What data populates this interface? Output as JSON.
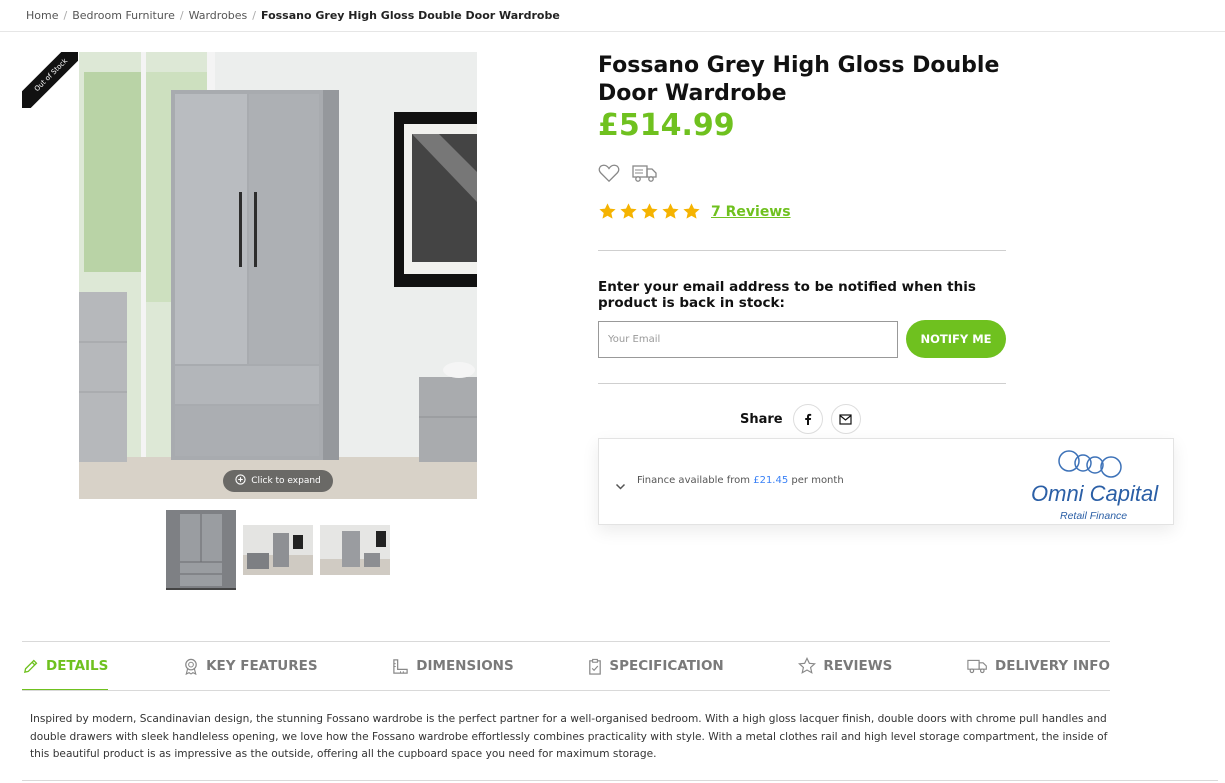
{
  "breadcrumb": {
    "items": [
      "Home",
      "Bedroom Furniture",
      "Wardrobes"
    ],
    "current": "Fossano Grey High Gloss Double Door Wardrobe"
  },
  "gallery": {
    "stock_ribbon": "Out of Stock",
    "expand_label": "Click to expand",
    "thumbnail_count": 3
  },
  "product": {
    "title": "Fossano Grey High Gloss Double Door Wardrobe",
    "price": "£514.99",
    "rating": 5,
    "reviews_label": "7 Reviews"
  },
  "notify": {
    "label": "Enter your email address to be notified when this product is back in stock:",
    "placeholder": "Your Email",
    "button": "NOTIFY ME"
  },
  "share": {
    "label": "Share",
    "icons": [
      "facebook-icon",
      "email-icon"
    ]
  },
  "finance": {
    "prefix": "Finance available from",
    "amount": "£21.45",
    "suffix": "per month",
    "provider_name": "Omni Capital",
    "provider_sub": "Retail Finance"
  },
  "tabs": [
    {
      "label": "DETAILS",
      "icon": "pencil-icon"
    },
    {
      "label": "KEY FEATURES",
      "icon": "award-icon"
    },
    {
      "label": "DIMENSIONS",
      "icon": "ruler-icon"
    },
    {
      "label": "SPECIFICATION",
      "icon": "clipboard-icon"
    },
    {
      "label": "REVIEWS",
      "icon": "star-icon"
    },
    {
      "label": "DELIVERY INFO",
      "icon": "truck-icon"
    }
  ],
  "description": "Inspired by modern, Scandinavian design, the stunning Fossano wardrobe is the perfect partner for a well-organised bedroom. With a high gloss lacquer finish, double doors with chrome pull handles and double drawers with sleek handleless opening, we love how the Fossano wardrobe effortlessly combines practicality with style. With a metal clothes rail and high level storage compartment, the inside of this beautiful product is as impressive as the outside, offering all the cupboard space you need for maximum storage.",
  "colors": {
    "accent": "#6fc11f",
    "star": "#f5b301",
    "finance_amount": "#3b82f6"
  }
}
